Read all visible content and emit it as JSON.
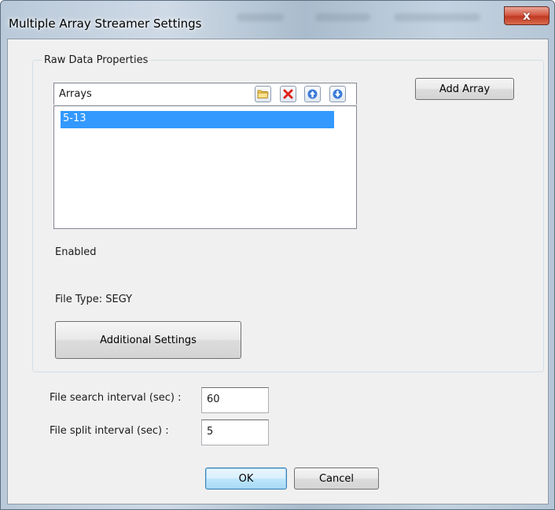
{
  "window": {
    "title": "Multiple Array Streamer Settings",
    "close_glyph": "x"
  },
  "raw_data": {
    "group_label": "Raw Data Properties",
    "arrays_header": "Arrays",
    "toolbar_icons": [
      "folder-icon",
      "delete-icon",
      "move-up-icon",
      "move-down-icon"
    ],
    "arrays": [
      "5-13"
    ],
    "add_array_label": "Add Array",
    "enabled_label": "Enabled",
    "file_type_label": "File Type: SEGY",
    "additional_settings_label": "Additional Settings"
  },
  "intervals": {
    "search_label": "File search interval (sec) :",
    "search_value": "60",
    "split_label": "File split interval (sec) :",
    "split_value": "5"
  },
  "footer": {
    "ok_label": "OK",
    "cancel_label": "Cancel"
  },
  "colors": {
    "selection": "#3399ff",
    "close_button": "#c8402a",
    "dialog_background": "#f0f0f0"
  }
}
